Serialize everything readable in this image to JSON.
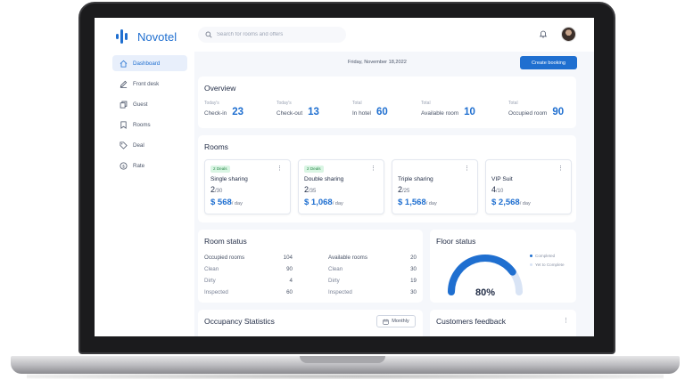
{
  "app": {
    "brand": "Novotel",
    "brand_color": "#1f6fd0"
  },
  "search": {
    "placeholder": "Search for rooms and offers"
  },
  "sidebar": {
    "items": [
      {
        "label": "Dashboard",
        "icon": "home-icon",
        "active": true
      },
      {
        "label": "Front desk",
        "icon": "pencil-icon",
        "active": false
      },
      {
        "label": "Guest",
        "icon": "copy-icon",
        "active": false
      },
      {
        "label": "Rooms",
        "icon": "bookmark-icon",
        "active": false
      },
      {
        "label": "Deal",
        "icon": "tag-icon",
        "active": false
      },
      {
        "label": "Rate",
        "icon": "dollar-icon",
        "active": false
      }
    ]
  },
  "header": {
    "date": "Friday, November 18,2022",
    "create_button": "Create booking"
  },
  "overview": {
    "title": "Overview",
    "stats": [
      {
        "small": "Today's",
        "label": "Check-in",
        "value": "23"
      },
      {
        "small": "Today's",
        "label": "Check-out",
        "value": "13"
      },
      {
        "small": "Total",
        "label": "In hotel",
        "value": "60"
      },
      {
        "small": "Total",
        "label": "Available room",
        "value": "10"
      },
      {
        "small": "Total",
        "label": "Occupied room",
        "value": "90"
      }
    ]
  },
  "rooms": {
    "title": "Rooms",
    "cards": [
      {
        "badge": "2 Deals",
        "name": "Single sharing",
        "occupied": "2",
        "total": "/30",
        "price": "$ 568",
        "per": "/ day"
      },
      {
        "badge": "2 Deals",
        "name": "Double sharing",
        "occupied": "2",
        "total": "/35",
        "price": "$ 1,068",
        "per": "/ day"
      },
      {
        "badge": "",
        "name": "Triple sharing",
        "occupied": "2",
        "total": "/25",
        "price": "$ 1,568",
        "per": "/ day"
      },
      {
        "badge": "",
        "name": "VIP Suit",
        "occupied": "4",
        "total": "/10",
        "price": "$ 2,568",
        "per": "/ day"
      }
    ]
  },
  "room_status": {
    "title": "Room status",
    "left": [
      {
        "label": "Occupied rooms",
        "value": "104"
      },
      {
        "label": "Clean",
        "value": "90"
      },
      {
        "label": "Dirty",
        "value": "4"
      },
      {
        "label": "Inspected",
        "value": "60"
      }
    ],
    "right": [
      {
        "label": "Available rooms",
        "value": "20"
      },
      {
        "label": "Clean",
        "value": "30"
      },
      {
        "label": "Dirty",
        "value": "19"
      },
      {
        "label": "Inspected",
        "value": "30"
      }
    ]
  },
  "floor_status": {
    "title": "Floor status",
    "percent_label": "80%",
    "progress": 0.8,
    "legend": [
      {
        "label": "Completed",
        "color": "#1f6fd0"
      },
      {
        "label": "Yet to Complete",
        "color": "#d9e4f5"
      }
    ]
  },
  "occupancy": {
    "title": "Occupancy Statistics",
    "period": "Monthly"
  },
  "feedback": {
    "title": "Customers feedback"
  }
}
